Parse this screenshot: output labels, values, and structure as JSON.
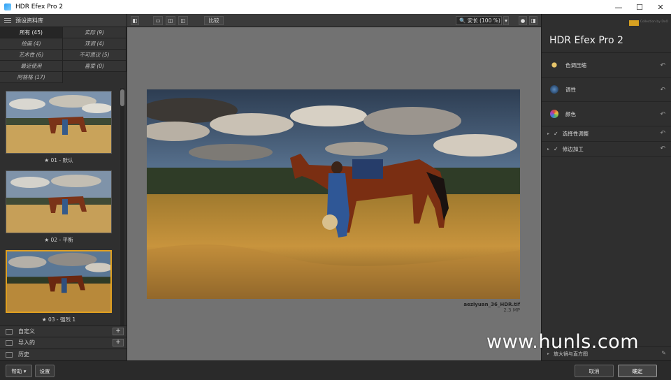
{
  "window": {
    "title": "HDR Efex Pro 2",
    "controls": {
      "minimize": "—",
      "maximize": "☐",
      "close": "✕"
    }
  },
  "library": {
    "header": "预设资料库",
    "categories": [
      {
        "label": "所有 (45)",
        "active": true
      },
      {
        "label": "实际 (9)",
        "active": false
      },
      {
        "label": "绘画 (4)",
        "active": false
      },
      {
        "label": "双调 (4)",
        "active": false
      },
      {
        "label": "艺术性 (6)",
        "active": false
      },
      {
        "label": "不可思议 (5)",
        "active": false
      },
      {
        "label": "最近使用",
        "active": false
      },
      {
        "label": "喜爱 (0)",
        "active": false
      },
      {
        "label": "阿格格 (17)",
        "active": false
      }
    ],
    "presets": [
      {
        "caption": "★ 01 - 默认",
        "selected": false
      },
      {
        "caption": "★ 02 - 平衡",
        "selected": false
      },
      {
        "caption": "★ 03 - 强烈 1",
        "selected": true
      }
    ],
    "sections": [
      {
        "label": "自定义",
        "icon": "folder-icon"
      },
      {
        "label": "导入的",
        "icon": "import-icon"
      },
      {
        "label": "历史",
        "icon": "history-icon"
      }
    ]
  },
  "toolbar": {
    "compare_label": "比较",
    "zoom_label": "🔍 安长 (100 %)",
    "zoom_dropdown": "▾"
  },
  "image": {
    "filename": "aeziyuan_36_HDR.tif",
    "size": "2.3 MP"
  },
  "right_panel": {
    "product": "HDR Efex Pro 2",
    "brand_small": "Collection by DxO",
    "adjustments": [
      {
        "label": "色调压缩",
        "icon": "sun-icon",
        "color": "#d8b45a"
      },
      {
        "label": "调性",
        "icon": "tonality-icon",
        "color": "#4c7ca8"
      },
      {
        "label": "颜色",
        "icon": "color-wheel-icon",
        "color": "#c0504d"
      }
    ],
    "expandables": [
      {
        "label": "选择性调整"
      },
      {
        "label": "修边加工"
      }
    ],
    "loupe_label": "放大镜与直方图",
    "undo_glyph": "↶",
    "check_glyph": "✓",
    "arrow_glyph": "▸"
  },
  "bottom": {
    "help_label": "帮助 ▾",
    "settings_label": "设置",
    "cancel_label": "取消",
    "ok_label": "确定"
  },
  "watermark": "www.hunls.com"
}
